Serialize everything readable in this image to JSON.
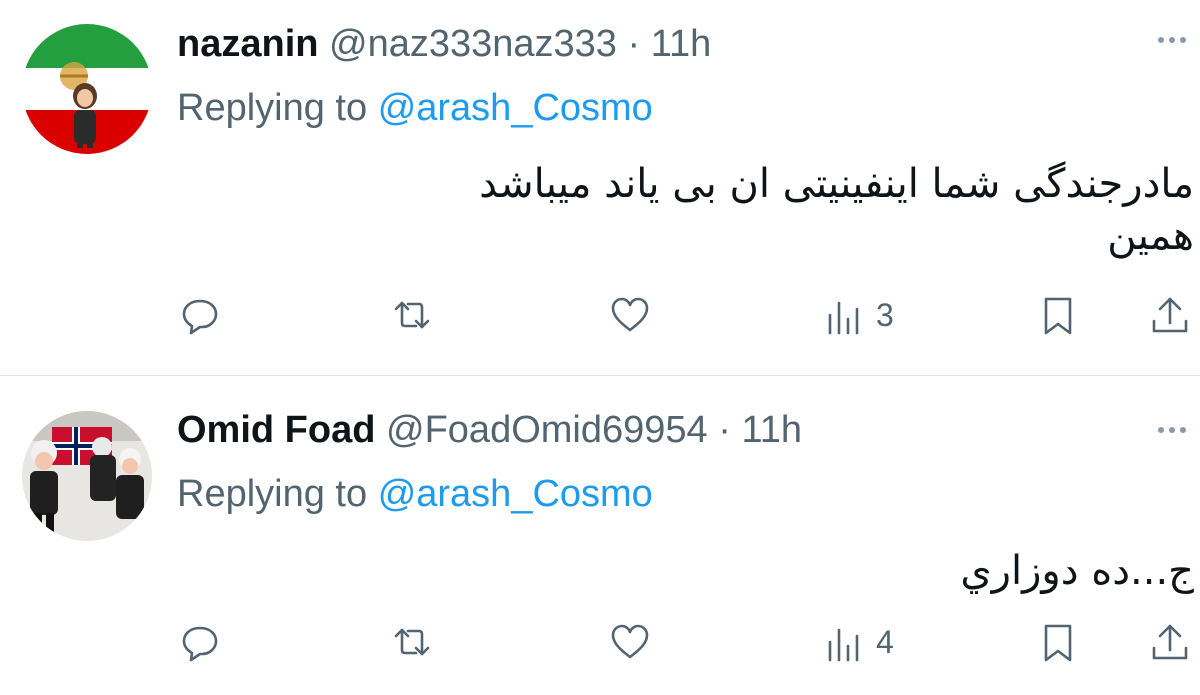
{
  "tweets": [
    {
      "name": "nazanin",
      "handle": "@naz333naz333",
      "separator": "·",
      "time": "11h",
      "replying_prefix": "Replying to",
      "replying_to": "@arash_Cosmo",
      "text": "مادرجندگی شما اینفینیتی ان بی یاند میباشد\nهمین",
      "actions": {
        "views_count": "3"
      }
    },
    {
      "name": "Omid Foad",
      "handle": "@FoadOmid69954",
      "separator": "·",
      "time": "11h",
      "replying_prefix": "Replying to",
      "replying_to": "@arash_Cosmo",
      "text": "ج...ده دوزاري",
      "actions": {
        "views_count": "4"
      }
    }
  ],
  "icons": {
    "reply": "reply-icon",
    "retweet": "retweet-icon",
    "like": "like-icon",
    "views": "views-icon",
    "bookmark": "bookmark-icon",
    "share": "share-icon",
    "more": "more-options-icon"
  },
  "colors": {
    "link": "#1d9bf0",
    "secondary_text": "#536471",
    "primary_text": "#0f1419"
  }
}
